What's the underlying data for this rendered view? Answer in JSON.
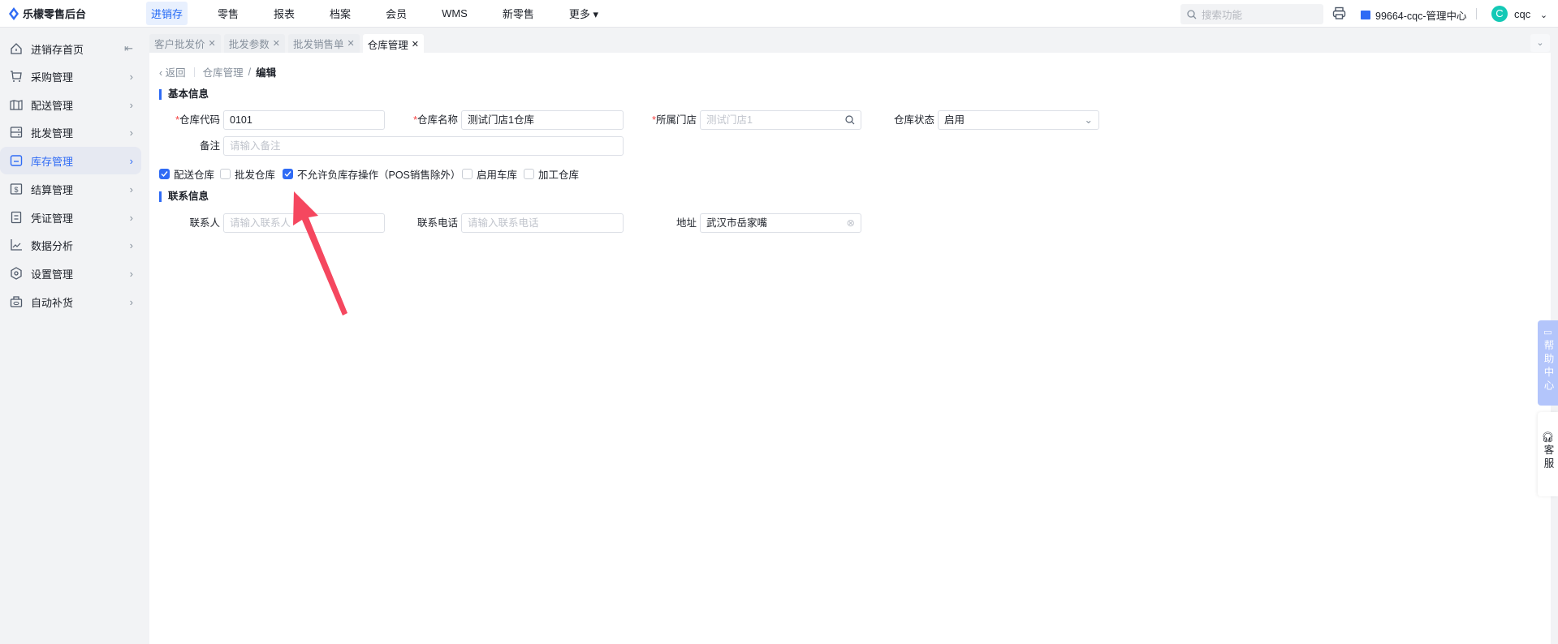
{
  "app": {
    "title": "乐檬零售后台"
  },
  "nav": [
    "进销存",
    "零售",
    "报表",
    "档案",
    "会员",
    "WMS",
    "新零售",
    "更多"
  ],
  "search": {
    "placeholder": "搜索功能"
  },
  "org": "99664-cqc-管理中心",
  "user": {
    "initial": "C",
    "name": "cqc"
  },
  "sidebar": [
    {
      "label": "进销存首页",
      "icon": "home-icon"
    },
    {
      "label": "采购管理",
      "icon": "cart-icon"
    },
    {
      "label": "配送管理",
      "icon": "map-icon"
    },
    {
      "label": "批发管理",
      "icon": "cabinet-icon"
    },
    {
      "label": "库存管理",
      "icon": "inventory-icon",
      "active": true
    },
    {
      "label": "结算管理",
      "icon": "dollar-icon"
    },
    {
      "label": "凭证管理",
      "icon": "document-icon"
    },
    {
      "label": "数据分析",
      "icon": "chart-icon"
    },
    {
      "label": "设置管理",
      "icon": "settings-icon"
    },
    {
      "label": "自动补货",
      "icon": "replenish-icon"
    }
  ],
  "tabs": [
    {
      "label": "客户批发价"
    },
    {
      "label": "批发参数"
    },
    {
      "label": "批发销售单"
    },
    {
      "label": "仓库管理",
      "active": true
    }
  ],
  "breadcrumb": {
    "back": "返回",
    "parent": "仓库管理",
    "current": "编辑"
  },
  "basic": {
    "title": "基本信息",
    "code": {
      "label": "仓库代码",
      "value": "0101"
    },
    "name": {
      "label": "仓库名称",
      "value": "测试门店1仓库"
    },
    "store": {
      "label": "所属门店",
      "placeholder": "测试门店1"
    },
    "status": {
      "label": "仓库状态",
      "value": "启用"
    },
    "remark": {
      "label": "备注",
      "placeholder": "请输入备注"
    },
    "checkboxes": [
      {
        "label": "配送仓库",
        "checked": true
      },
      {
        "label": "批发仓库",
        "checked": false
      },
      {
        "label": "不允许负库存操作（POS销售除外）",
        "checked": true
      },
      {
        "label": "启用车库",
        "checked": false
      },
      {
        "label": "加工仓库",
        "checked": false
      }
    ]
  },
  "contact": {
    "title": "联系信息",
    "person": {
      "label": "联系人",
      "placeholder": "请输入联系人"
    },
    "phone": {
      "label": "联系电话",
      "placeholder": "请输入联系电话"
    },
    "address": {
      "label": "地址",
      "value": "武汉市岳家嘴"
    }
  },
  "float": {
    "help": "帮助中心",
    "service": "客服"
  },
  "colors": {
    "accent": "#2f6bf5",
    "arrow": "#f5475f",
    "avatar": "#14c9b6"
  }
}
